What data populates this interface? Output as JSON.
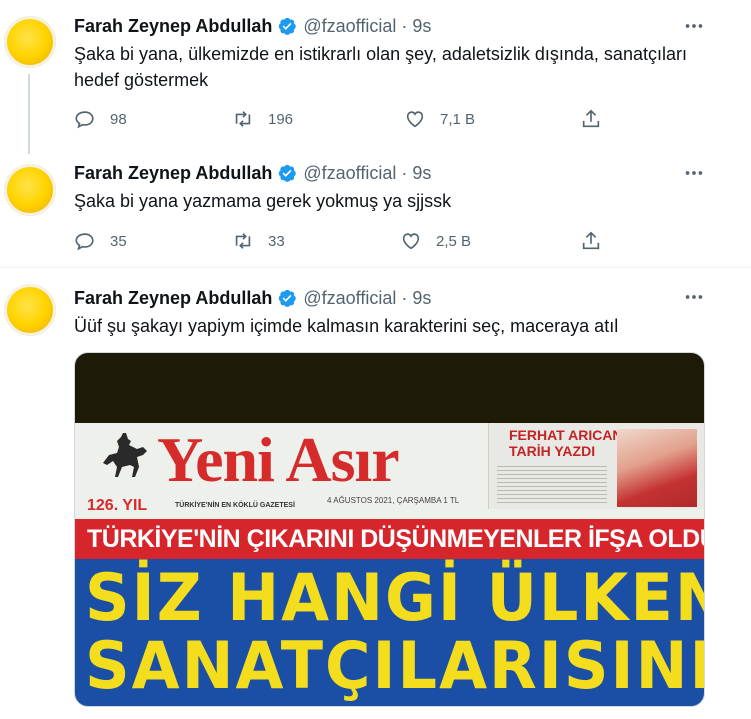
{
  "tweets": [
    {
      "name": "Farah Zeynep Abdullah",
      "handle": "@fzaofficial",
      "dot": "·",
      "time": "9s",
      "text": "Şaka bi yana, ülkemizde en istikrarlı olan şey, adaletsizlik dışında, sanatçıları hedef göstermek",
      "replies": "98",
      "retweets": "196",
      "likes": "7,1 B"
    },
    {
      "name": "Farah Zeynep Abdullah",
      "handle": "@fzaofficial",
      "dot": "·",
      "time": "9s",
      "text": "Şaka bi yana yazmama gerek yokmuş ya sjjssk",
      "replies": "35",
      "retweets": "33",
      "likes": "2,5 B"
    },
    {
      "name": "Farah Zeynep Abdullah",
      "handle": "@fzaofficial",
      "dot": "·",
      "time": "9s",
      "text": "Üüf şu şakayı yapiym içimde kalmasın karakterini seç, maceraya atıl"
    }
  ],
  "newspaper": {
    "masthead": "Yeni Asır",
    "year": "126. YIL",
    "slogan": "TÜRKİYE'NİN EN KÖKLÜ GAZETESİ",
    "date": "4 AĞUSTOS 2021, ÇARŞAMBA   1 TL",
    "side_title_1": "FERHAT ARICAN",
    "side_title_2": "TARİH YAZDI",
    "red_headline": "TÜRKİYE'NİN ÇIKARINI DÜŞÜNMEYENLER İFŞA OLDU",
    "big_line_1": "SİZ HANGİ ÜLKENİN",
    "big_line_2": "SANATÇILARISINIZ"
  },
  "icons": {
    "verified": "verified-badge-icon",
    "more": "more-options-icon",
    "reply": "reply-icon",
    "retweet": "retweet-icon",
    "like": "like-icon",
    "share": "share-icon"
  },
  "colors": {
    "verified_blue": "#1d9bf0",
    "muted_text": "#536471",
    "avatar_yellow": "#ffd400"
  }
}
